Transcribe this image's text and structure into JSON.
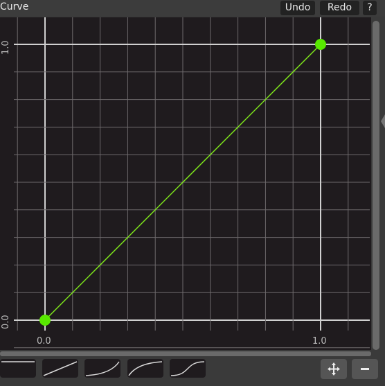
{
  "header": {
    "title": "Curve",
    "undo_label": "Undo",
    "redo_label": "Redo",
    "help_label": "?"
  },
  "curve_editor": {
    "y_tick_top": "1.0",
    "y_tick_bottom": "0.0",
    "x_tick_left": "0.0",
    "x_tick_right": "1.0",
    "curve_color": "#7fe81b",
    "point_color": "#58e800",
    "points": [
      {
        "x": 0.0,
        "y": 0.0
      },
      {
        "x": 1.0,
        "y": 1.0
      }
    ]
  },
  "presets": [
    {
      "icon": "flat-curve-icon"
    },
    {
      "icon": "linear-curve-icon"
    },
    {
      "icon": "ease-in-curve-icon"
    },
    {
      "icon": "ease-out-curve-icon"
    },
    {
      "icon": "s-curve-icon"
    }
  ],
  "tools": {
    "add_icon": "move-point-icon",
    "remove_icon": "remove-point-icon"
  }
}
